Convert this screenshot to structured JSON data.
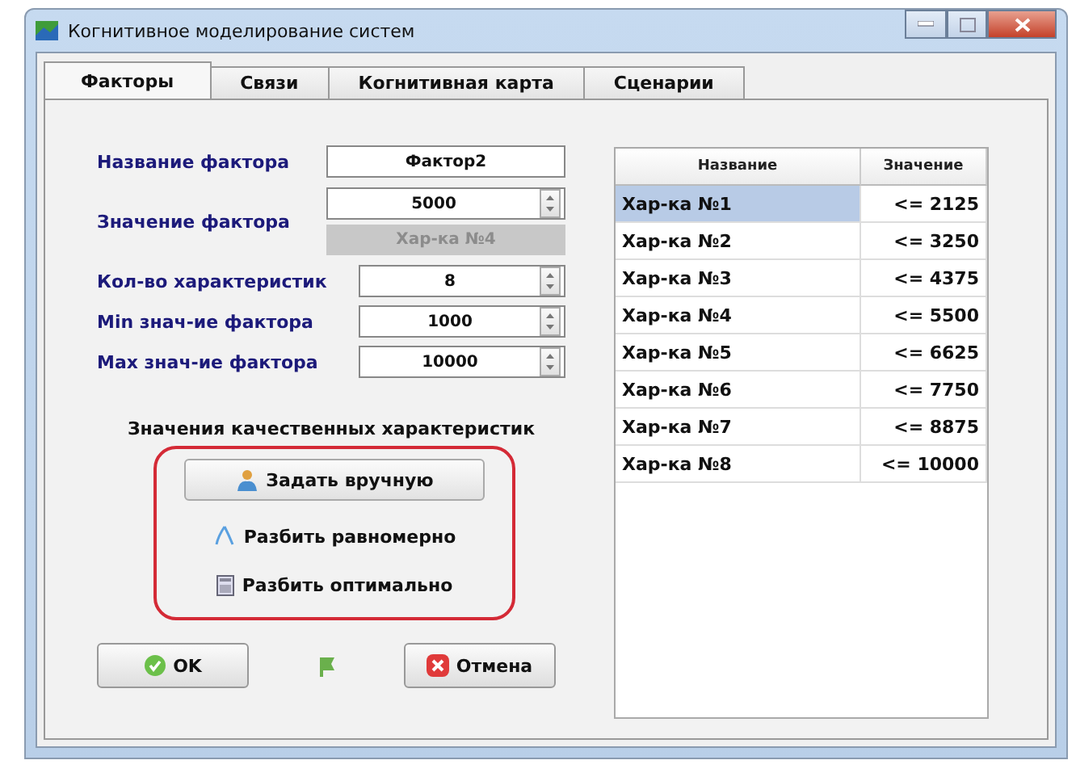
{
  "window": {
    "title": "Когнитивное моделирование систем"
  },
  "tabs": [
    {
      "label": "Факторы",
      "selected": true
    },
    {
      "label": "Связи",
      "selected": false
    },
    {
      "label": "Когнитивная карта",
      "selected": false
    },
    {
      "label": "Сценарии",
      "selected": false
    }
  ],
  "form": {
    "name_label": "Название фактора",
    "name_value": "Фактор2",
    "value_label": "Значение фактора",
    "value": "5000",
    "characteristic_button": {
      "label": "Хар-ка №4",
      "disabled": true
    },
    "fields": [
      {
        "label": "Кол-во характеристик",
        "value": "8"
      },
      {
        "label": "Min знач-ие фактора",
        "value": "1000"
      },
      {
        "label": "Max знач-ие фактора",
        "value": "10000"
      }
    ]
  },
  "qualitative": {
    "heading": "Значения качественных характеристик",
    "actions": [
      {
        "kind": "button",
        "label": "Задать вручную"
      },
      {
        "kind": "flat",
        "label": "Разбить равномерно"
      },
      {
        "kind": "flat",
        "label": "Разбить оптимально"
      }
    ]
  },
  "table": {
    "columns": [
      "Название",
      "Значение"
    ],
    "rows": [
      {
        "name": "Хар-ка №1",
        "value": "<= 2125",
        "selected": true
      },
      {
        "name": "Хар-ка №2",
        "value": "<= 3250",
        "selected": false
      },
      {
        "name": "Хар-ка №3",
        "value": "<= 4375",
        "selected": false
      },
      {
        "name": "Хар-ка №4",
        "value": "<= 5500",
        "selected": false
      },
      {
        "name": "Хар-ка №5",
        "value": "<= 6625",
        "selected": false
      },
      {
        "name": "Хар-ка №6",
        "value": "<= 7750",
        "selected": false
      },
      {
        "name": "Хар-ка №7",
        "value": "<= 8875",
        "selected": false
      },
      {
        "name": "Хар-ка №8",
        "value": "<= 10000",
        "selected": false
      }
    ]
  },
  "buttons": {
    "ok": "OK",
    "cancel": "Отмена"
  }
}
